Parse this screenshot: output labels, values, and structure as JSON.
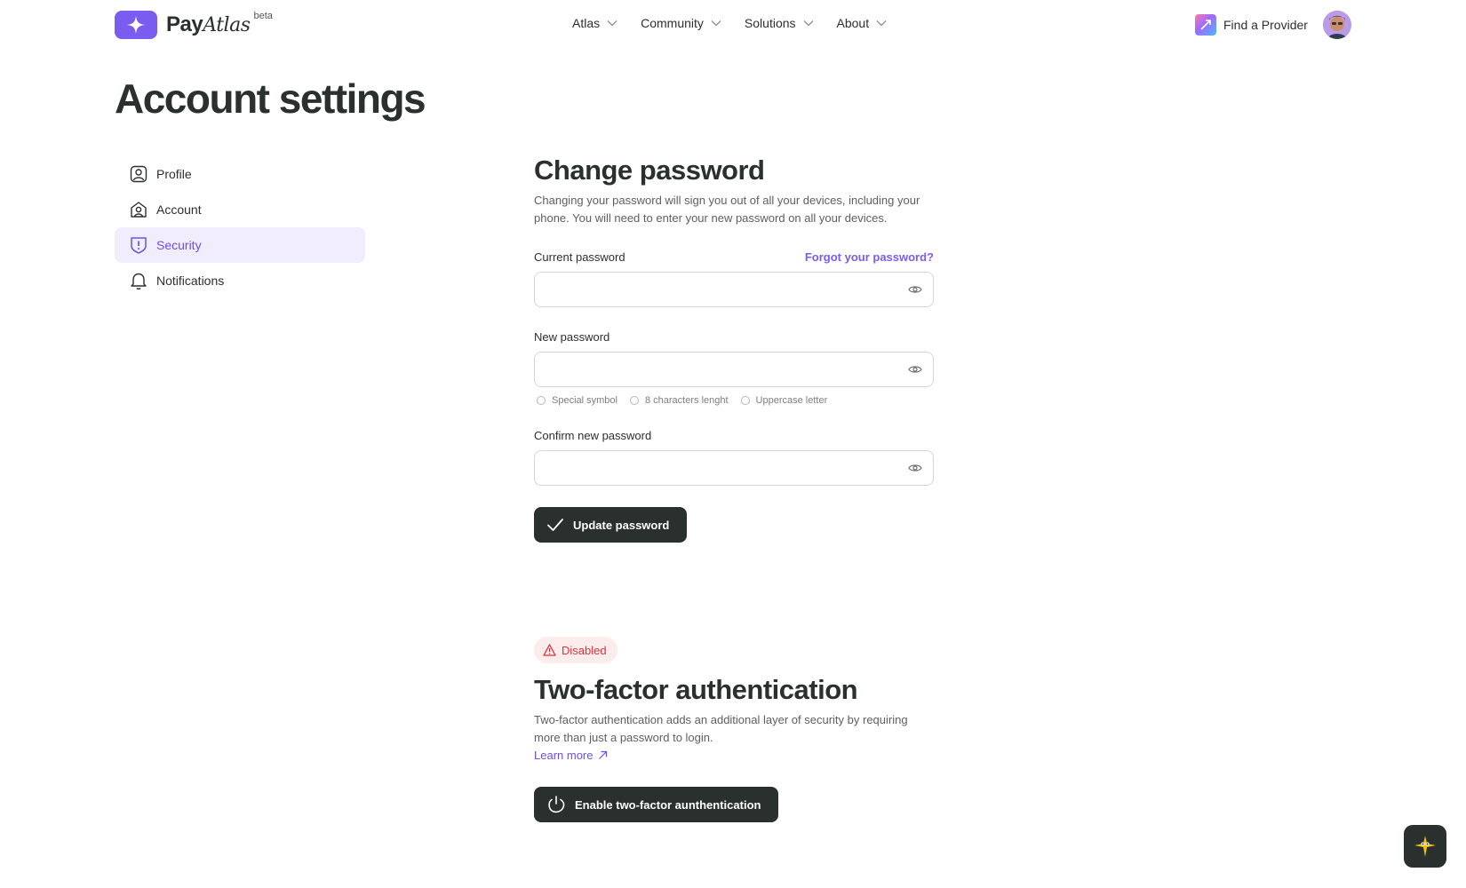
{
  "header": {
    "logo_pay": "Pay",
    "logo_atlas": "Atlas",
    "logo_badge": "beta",
    "nav": [
      {
        "label": "Atlas"
      },
      {
        "label": "Community"
      },
      {
        "label": "Solutions"
      },
      {
        "label": "About"
      }
    ],
    "find_provider": "Find a Provider"
  },
  "page": {
    "title": "Account settings"
  },
  "sidebar": {
    "items": [
      {
        "label": "Profile",
        "icon": "profile-icon",
        "active": false
      },
      {
        "label": "Account",
        "icon": "account-icon",
        "active": false
      },
      {
        "label": "Security",
        "icon": "shield-icon",
        "active": true
      },
      {
        "label": "Notifications",
        "icon": "bell-icon",
        "active": false
      }
    ]
  },
  "change_password": {
    "title": "Change password",
    "description": "Changing your password will sign you out of all your devices, including your phone. You will need to enter your new password on all your devices.",
    "current_label": "Current password",
    "forgot_link": "Forgot your password?",
    "current_value": "",
    "new_label": "New password",
    "new_value": "",
    "requirements": [
      "Special symbol",
      "8 characters lenght",
      "Uppercase letter"
    ],
    "confirm_label": "Confirm new password",
    "confirm_value": "",
    "submit_label": "Update password"
  },
  "two_factor": {
    "status_badge": "Disabled",
    "title": "Two-factor authentication",
    "description": "Two-factor authentication adds an additional layer of security by requiring more than just a password to login.",
    "learn_more": "Learn more",
    "enable_label": "Enable two-factor aunthentication"
  },
  "colors": {
    "accent": "#7b5cf0",
    "dark_button": "#2a302d",
    "active_bg": "#f1edfd",
    "danger": "#d6343a",
    "danger_bg": "#fdecec"
  }
}
